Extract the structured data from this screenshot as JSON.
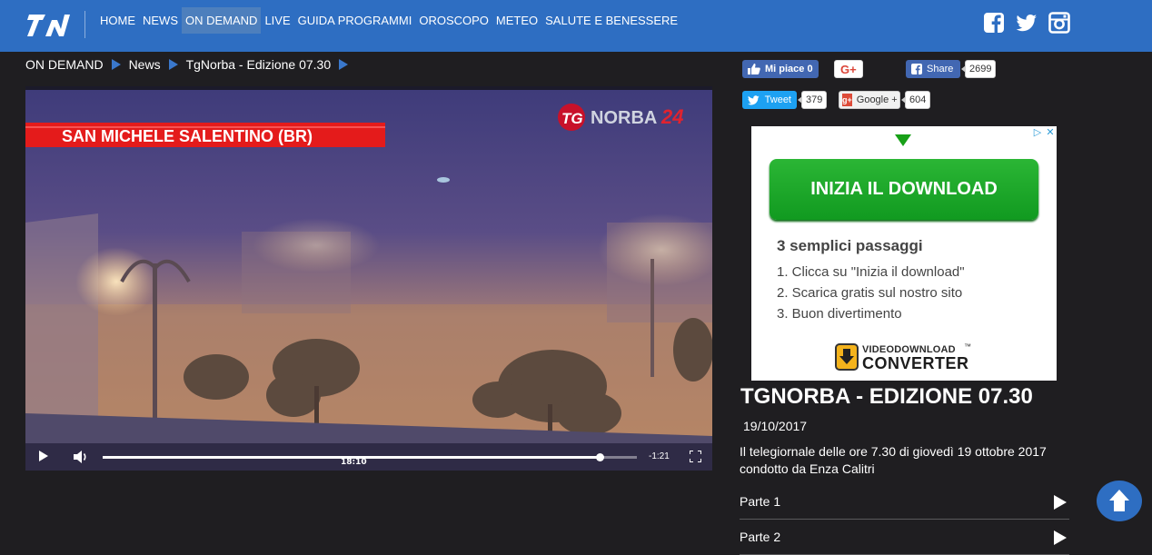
{
  "colors": {
    "header": "#2e6ec2",
    "page_bg": "#1f1e21",
    "accent_arrow": "#3a78cc",
    "cta_green": "#19a526"
  },
  "header": {
    "logo_icon": "tgnorba-logo",
    "nav": [
      "HOME",
      "NEWS",
      "ON DEMAND",
      "LIVE",
      "GUIDA PROGRAMMI",
      "OROSCOPO",
      "METEO",
      "SALUTE E BENESSERE"
    ],
    "active_nav": "ON DEMAND",
    "social_icons": [
      "facebook-icon",
      "twitter-icon",
      "instagram-icon"
    ]
  },
  "breadcrumb": [
    "ON DEMAND",
    "News",
    "TgNorba - Edizione 07.30"
  ],
  "video": {
    "overlay_caption": "SAN MICHELE SALENTINO (BR)",
    "channel_logo_tg": "TG",
    "channel_logo_norba": "NORBA",
    "channel_logo_num": "24",
    "current_time": "18:10",
    "remaining": "-1:21",
    "progress": 0.93
  },
  "share": {
    "fb_like_label": "Mi piace 0",
    "gplus_label": "G+",
    "fb_share_label": "Share",
    "fb_share_count": "2699",
    "tweet_label": "Tweet",
    "tweet_count": "379",
    "google_label": "Google +",
    "google_count": "604"
  },
  "ad": {
    "cta": "INIZIA IL DOWNLOAD",
    "steps_title": "3 semplici passaggi",
    "steps": [
      "1. Clicca su \"Inizia il download\"",
      "2. Scarica gratis sul nostro sito",
      "3. Buon divertimento"
    ],
    "brand_top": "VIDEODOWNLOAD",
    "brand_tm": "™",
    "brand_bottom": "CONVERTER",
    "choices_icon": "▷",
    "close_icon": "✕"
  },
  "episode": {
    "title": "TGNORBA - EDIZIONE 07.30",
    "date": "19/10/2017",
    "description": "Il telegiornale delle ore 7.30 di giovedì 19 ottobre 2017 condotto da Enza Calitri",
    "parts": [
      "Parte 1",
      "Parte 2"
    ]
  }
}
